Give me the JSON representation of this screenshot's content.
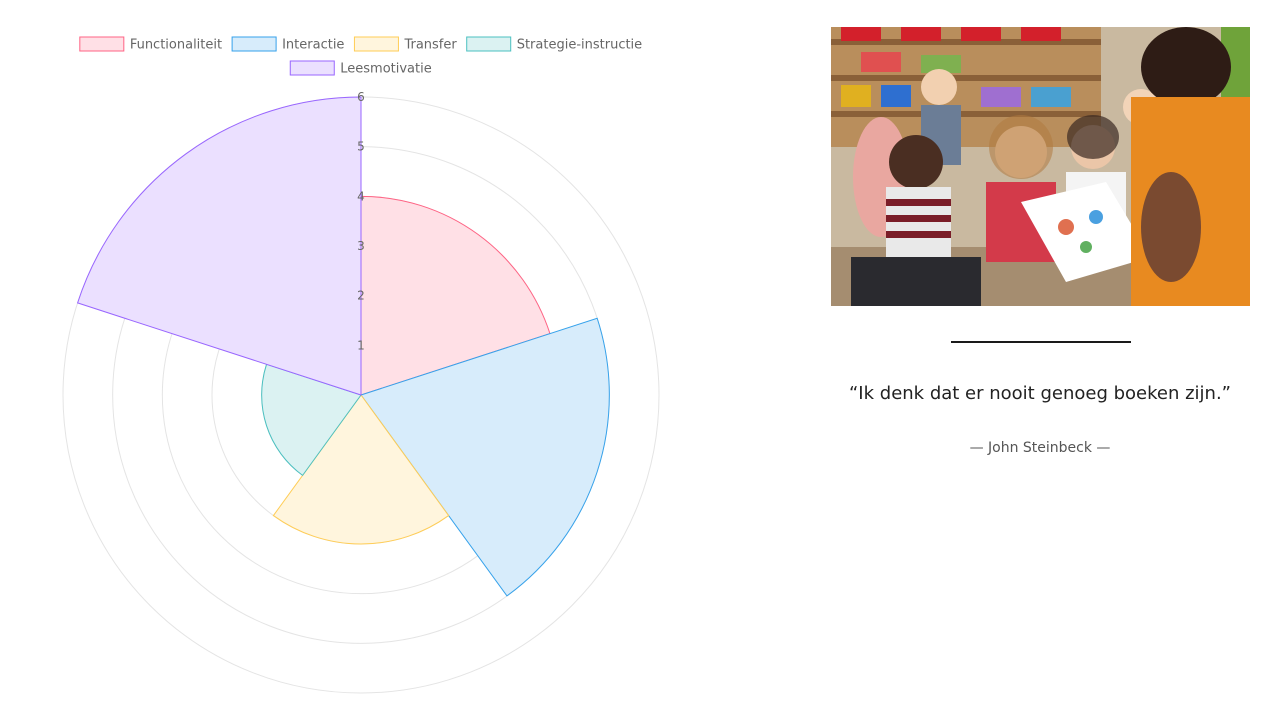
{
  "chart_data": {
    "type": "polarArea",
    "title": "",
    "categories": [
      "Functionaliteit",
      "Interactie",
      "Transfer",
      "Strategie-instructie",
      "Leesmotivatie"
    ],
    "values": [
      4,
      5,
      3,
      2,
      6
    ],
    "colors": {
      "fill": [
        "#ffe0e6",
        "#d7ecfb",
        "#fff5dd",
        "#dbf2f2",
        "#ebe0ff"
      ],
      "stroke": [
        "#ff6384",
        "#36a2eb",
        "#ffcd56",
        "#4bc0c0",
        "#9966ff"
      ]
    },
    "r_range": [
      0,
      6
    ],
    "ticks": [
      "1",
      "2",
      "3",
      "4",
      "5",
      "6"
    ],
    "grid": true,
    "legend_position": "top"
  },
  "quote": {
    "text": "“Ik denk dat er nooit genoeg boeken zijn.”",
    "author": "— John Steinbeck —"
  }
}
